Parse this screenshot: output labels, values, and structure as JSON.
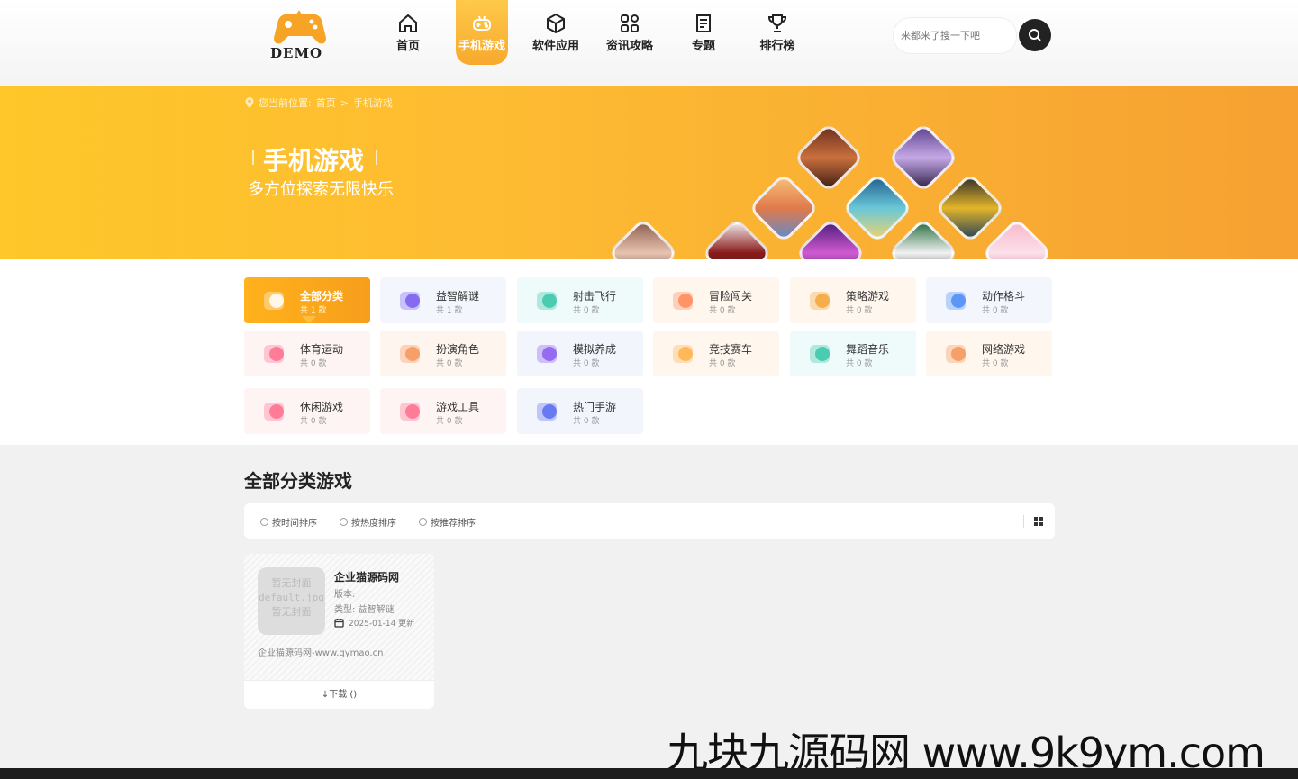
{
  "header": {
    "logo_text": "DEMO",
    "nav": [
      {
        "label": "首页",
        "icon": "home-icon"
      },
      {
        "label": "手机游戏",
        "icon": "gamepad-icon",
        "active": true
      },
      {
        "label": "软件应用",
        "icon": "cube-icon"
      },
      {
        "label": "资讯攻略",
        "icon": "grid-icon"
      },
      {
        "label": "专题",
        "icon": "document-icon"
      },
      {
        "label": "排行榜",
        "icon": "trophy-icon"
      }
    ],
    "search_placeholder": "来都来了搜一下吧"
  },
  "banner": {
    "breadcrumb_prefix": "您当前位置:",
    "breadcrumb_home": "首页",
    "breadcrumb_sep": ">",
    "breadcrumb_current": "手机游戏",
    "title": "手机游戏",
    "subtitle": "多方位探索无限快乐"
  },
  "categories": [
    {
      "name": "全部分类",
      "count": "共 1 款",
      "active": true
    },
    {
      "name": "益智解谜",
      "count": "共 1 款"
    },
    {
      "name": "射击飞行",
      "count": "共 0 款"
    },
    {
      "name": "冒险闯关",
      "count": "共 0 款"
    },
    {
      "name": "策略游戏",
      "count": "共 0 款"
    },
    {
      "name": "动作格斗",
      "count": "共 0 款"
    },
    {
      "name": "体育运动",
      "count": "共 0 款"
    },
    {
      "name": "扮演角色",
      "count": "共 0 款"
    },
    {
      "name": "模拟养成",
      "count": "共 0 款"
    },
    {
      "name": "竞技赛车",
      "count": "共 0 款"
    },
    {
      "name": "舞蹈音乐",
      "count": "共 0 款"
    },
    {
      "name": "网络游戏",
      "count": "共 0 款"
    },
    {
      "name": "休闲游戏",
      "count": "共 0 款"
    },
    {
      "name": "游戏工具",
      "count": "共 0 款"
    },
    {
      "name": "热门手游",
      "count": "共 0 款"
    }
  ],
  "list": {
    "title": "全部分类游戏",
    "sort_options": [
      "按时间排序",
      "按热度排序",
      "按推荐排序"
    ]
  },
  "card": {
    "cover_text": [
      "暂无封面",
      "default.jpg",
      "暂无封面"
    ],
    "title": "企业猫源码网",
    "version": "版本:",
    "type": "类型: 益智解谜",
    "date": "2025-01-14 更新",
    "desc": "企业猫源码网-www.qymao.cn",
    "download": "↓下载 ()"
  },
  "watermark": "九块九源码网 www.9k9ym.com",
  "colors": {
    "accent": "#fbb52a",
    "dark": "#222222"
  }
}
